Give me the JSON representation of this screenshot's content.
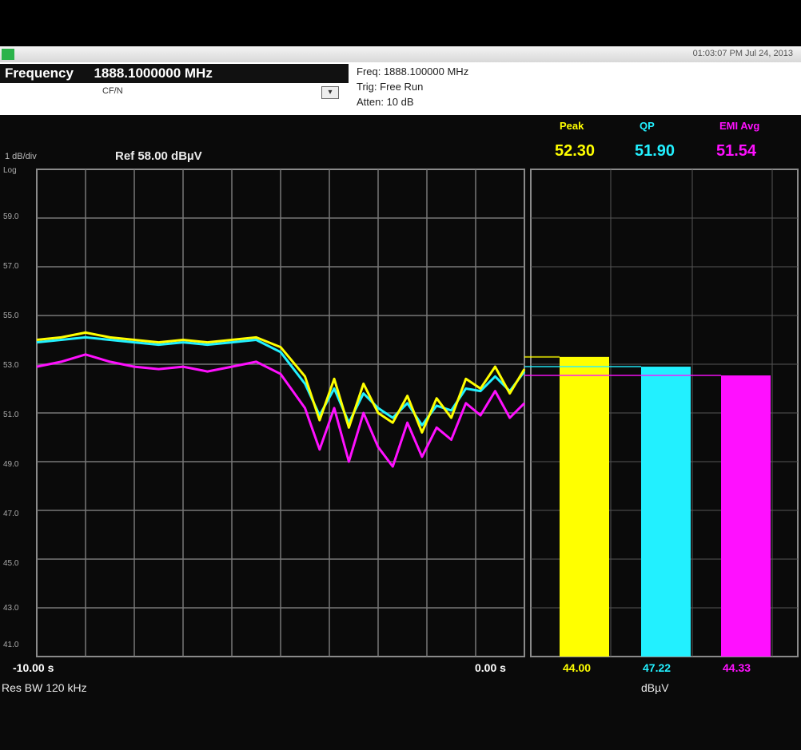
{
  "title_bar": {
    "status_text": "01:03:07 PM Jul 24, 2013"
  },
  "frequency": {
    "label": "Frequency",
    "value": "1888.1000000 MHz",
    "sub_label": "CF/N"
  },
  "status": {
    "freq_line": "Freq: 1888.100000 MHz",
    "trig_line": "Trig: Free Run",
    "atten_line": "Atten: 10 dB"
  },
  "plot": {
    "scale_label": "1 dB/div",
    "ref_label": "Ref 58.00 dBµV",
    "x_start": "-10.00 s",
    "x_end": "0.00 s",
    "res_bw": "Res BW 120 kHz"
  },
  "y_ticks": [
    "Log",
    "59.0",
    "57.0",
    "55.0",
    "53.0",
    "51.0",
    "49.0",
    "47.0",
    "45.0",
    "43.0",
    "41.0"
  ],
  "meters": {
    "units": "dBµV",
    "items": [
      {
        "name": "Peak",
        "value": "52.30",
        "bottom_value": "44.00",
        "color": "#ffff00"
      },
      {
        "name": "QP",
        "value": "51.90",
        "bottom_value": "47.22",
        "color": "#22f0ff"
      },
      {
        "name": "EMI Avg",
        "value": "51.54",
        "bottom_value": "44.33",
        "color": "#ff10ff"
      }
    ]
  },
  "chart_data": {
    "type": "line",
    "title": "",
    "xlabel": "",
    "ylabel": "",
    "xlim": [
      -10,
      0
    ],
    "ylim": [
      40,
      60
    ],
    "grid": true,
    "series": [
      {
        "name": "Peak",
        "color": "#ffff00",
        "x": [
          -10,
          -9.5,
          -9.0,
          -8.5,
          -8.0,
          -7.5,
          -7.0,
          -6.5,
          -6.0,
          -5.5,
          -5.0,
          -4.5,
          -4.2,
          -3.9,
          -3.6,
          -3.3,
          -3.0,
          -2.7,
          -2.4,
          -2.1,
          -1.8,
          -1.5,
          -1.2,
          -0.9,
          -0.6,
          -0.3,
          0
        ],
        "y": [
          53.0,
          53.1,
          53.3,
          53.1,
          53.0,
          52.9,
          53.0,
          52.9,
          53.0,
          53.1,
          52.7,
          51.5,
          49.7,
          51.4,
          49.4,
          51.2,
          50.0,
          49.6,
          50.7,
          49.2,
          50.6,
          49.8,
          51.4,
          51.0,
          51.9,
          50.8,
          51.8
        ]
      },
      {
        "name": "QP",
        "color": "#22f0ff",
        "x": [
          -10,
          -9.5,
          -9.0,
          -8.5,
          -8.0,
          -7.5,
          -7.0,
          -6.5,
          -6.0,
          -5.5,
          -5.0,
          -4.5,
          -4.2,
          -3.9,
          -3.6,
          -3.3,
          -3.0,
          -2.7,
          -2.4,
          -2.1,
          -1.8,
          -1.5,
          -1.2,
          -0.9,
          -0.6,
          -0.3,
          0
        ],
        "y": [
          52.9,
          53.0,
          53.1,
          53.0,
          52.9,
          52.8,
          52.9,
          52.8,
          52.9,
          53.0,
          52.5,
          51.2,
          49.9,
          51.0,
          49.6,
          50.8,
          50.2,
          49.8,
          50.4,
          49.5,
          50.3,
          50.1,
          51.0,
          50.9,
          51.5,
          50.9,
          51.7
        ]
      },
      {
        "name": "EMI Avg",
        "color": "#ff10ff",
        "x": [
          -10,
          -9.5,
          -9.0,
          -8.5,
          -8.0,
          -7.5,
          -7.0,
          -6.5,
          -6.0,
          -5.5,
          -5.0,
          -4.5,
          -4.2,
          -3.9,
          -3.6,
          -3.3,
          -3.0,
          -2.7,
          -2.4,
          -2.1,
          -1.8,
          -1.5,
          -1.2,
          -0.9,
          -0.6,
          -0.3,
          0
        ],
        "y": [
          51.9,
          52.1,
          52.4,
          52.1,
          51.9,
          51.8,
          51.9,
          51.7,
          51.9,
          52.1,
          51.6,
          50.2,
          48.5,
          50.2,
          48.0,
          50.0,
          48.6,
          47.8,
          49.6,
          48.2,
          49.4,
          48.9,
          50.4,
          49.9,
          50.9,
          49.8,
          50.4
        ]
      }
    ]
  }
}
